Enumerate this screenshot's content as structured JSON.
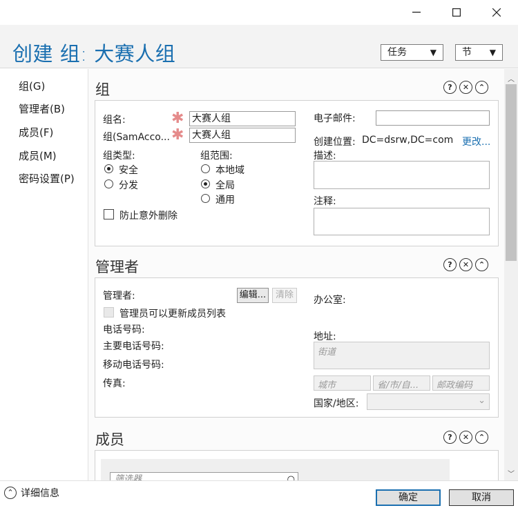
{
  "window": {
    "minimize": "—",
    "maximize": "☐",
    "close": "✕"
  },
  "header": {
    "title": "创建 组: 大赛人组",
    "dropdown_tasks": "任务",
    "dropdown_sections": "节"
  },
  "nav": {
    "items": [
      "组(G)",
      "管理者(B)",
      "成员(F)",
      "成员(M)",
      "密码设置(P)"
    ]
  },
  "group_section": {
    "title": "组",
    "name_label": "组名:",
    "name_value": "大赛人组",
    "sam_label": "组(SamAcco...",
    "sam_value": "大赛人组",
    "type_label": "组类型:",
    "type_options": [
      "安全",
      "分发"
    ],
    "type_selected": "安全",
    "scope_label": "组范围:",
    "scope_options": [
      "本地域",
      "全局",
      "通用"
    ],
    "scope_selected": "全局",
    "protect_label": "防止意外删除",
    "email_label": "电子邮件:",
    "email_value": "",
    "location_label": "创建位置:",
    "location_value": "DC=dsrw,DC=com",
    "change_link": "更改...",
    "description_label": "描述:",
    "notes_label": "注释:"
  },
  "manager_section": {
    "title": "管理者",
    "manager_label": "管理者:",
    "edit_button": "编辑...",
    "clear_button": "清除",
    "can_update_label": "管理员可以更新成员列表",
    "phone_label": "电话号码:",
    "main_phone_label": "主要电话号码:",
    "mobile_label": "移动电话号码:",
    "fax_label": "传真:",
    "office_label": "办公室:",
    "address_label": "地址:",
    "street_placeholder": "街道",
    "city_placeholder": "城市",
    "state_placeholder": "省/市/自...",
    "zip_placeholder": "邮政编码",
    "country_label": "国家/地区:"
  },
  "members_section": {
    "title": "成员",
    "filter_placeholder": "筛选器"
  },
  "footer": {
    "details": "详细信息",
    "ok": "确定",
    "cancel": "取消"
  },
  "colors": {
    "title_blue": "#1a6fb0",
    "link_blue": "#1a6fb0",
    "required_star": "#e58b8b"
  }
}
